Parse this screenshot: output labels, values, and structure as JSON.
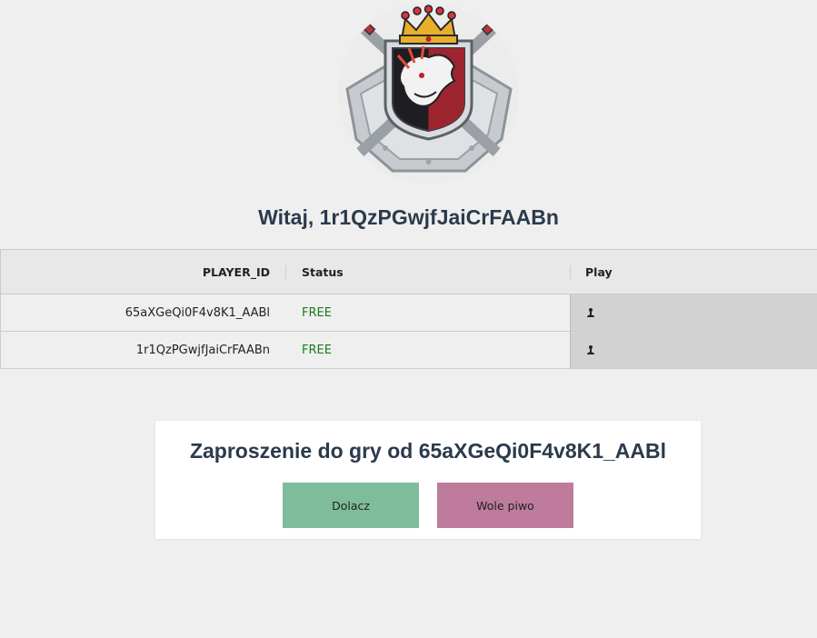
{
  "welcome": {
    "text": "Witaj, 1r1QzPGwjfJaiCrFAABn"
  },
  "logo": {
    "icon": "crowned-warrior-crest-logo"
  },
  "players_table": {
    "headers": {
      "player_id": "PLAYER_ID",
      "status": "Status",
      "play": "Play"
    },
    "rows": [
      {
        "player_id": "65aXGeQi0F4v8K1_AABl",
        "status": "FREE",
        "play_icon": "pawn-icon"
      },
      {
        "player_id": "1r1QzPGwjfJaiCrFAABn",
        "status": "FREE",
        "play_icon": "pawn-icon"
      }
    ],
    "status_color": "#1d7a1d"
  },
  "invite": {
    "title": "Zaproszenie do gry od 65aXGeQi0F4v8K1_AABl",
    "join_label": "Dolacz",
    "decline_label": "Wole piwo",
    "join_color": "#7fbc9c",
    "decline_color": "#be7b9c"
  }
}
